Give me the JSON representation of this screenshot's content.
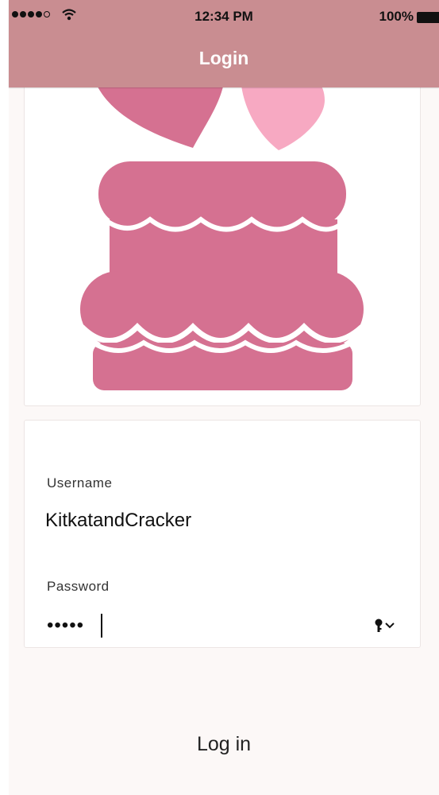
{
  "status_bar": {
    "time": "12:34 PM",
    "battery": "100%"
  },
  "nav": {
    "title": "Login"
  },
  "illustration": {
    "icon": "cake-with-hearts-icon",
    "colors": {
      "cake": "#d57191",
      "heart_dark": "#d57191",
      "heart_light": "#f7a9c2"
    }
  },
  "form": {
    "username": {
      "label": "Username",
      "value": "KitkatandCracker"
    },
    "password": {
      "label": "Password",
      "masked_value": "•••••",
      "icon": "key-icon"
    }
  },
  "actions": {
    "login_label": "Log in"
  },
  "colors": {
    "header": "#c98d91",
    "background": "#fcf8f7",
    "card": "#ffffff"
  }
}
